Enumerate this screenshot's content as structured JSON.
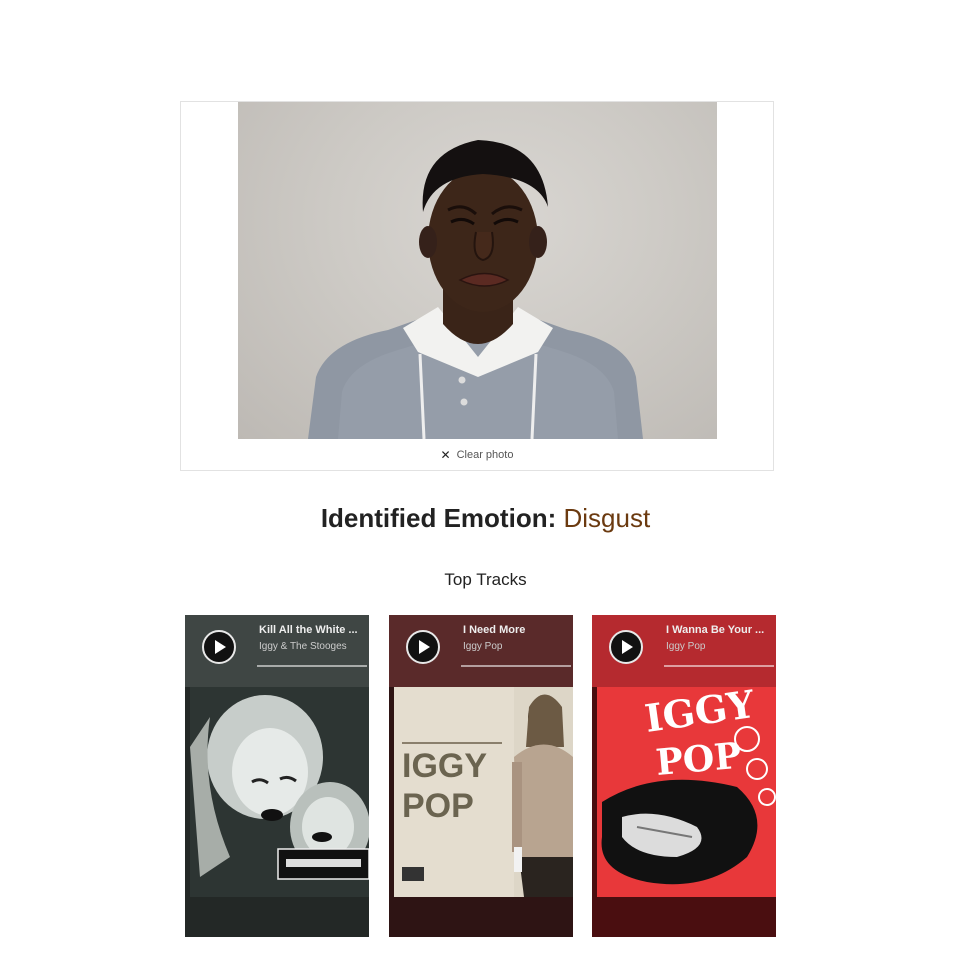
{
  "photo_card": {
    "clear_label": "Clear photo"
  },
  "emotion": {
    "label": "Identified Emotion: ",
    "value": "Disgust"
  },
  "top_tracks_heading": "Top Tracks",
  "tracks": [
    {
      "title": "Kill All the White ...",
      "artist": "Iggy & The Stooges",
      "header_color": "#3f4644",
      "footer_color": "#232826",
      "icon": "play-icon"
    },
    {
      "title": "I Need More",
      "artist": "Iggy Pop",
      "header_color": "#5a2a2a",
      "footer_color": "#2e1414",
      "cover_text_1": "IGGY",
      "cover_text_2": "POP",
      "icon": "play-icon"
    },
    {
      "title": "I Wanna Be Your ...",
      "artist": "Iggy Pop",
      "header_color": "#b52a2f",
      "footer_color": "#4a0e10",
      "cover_text_1": "IGGY",
      "cover_text_2": "POP",
      "icon": "play-icon"
    }
  ]
}
